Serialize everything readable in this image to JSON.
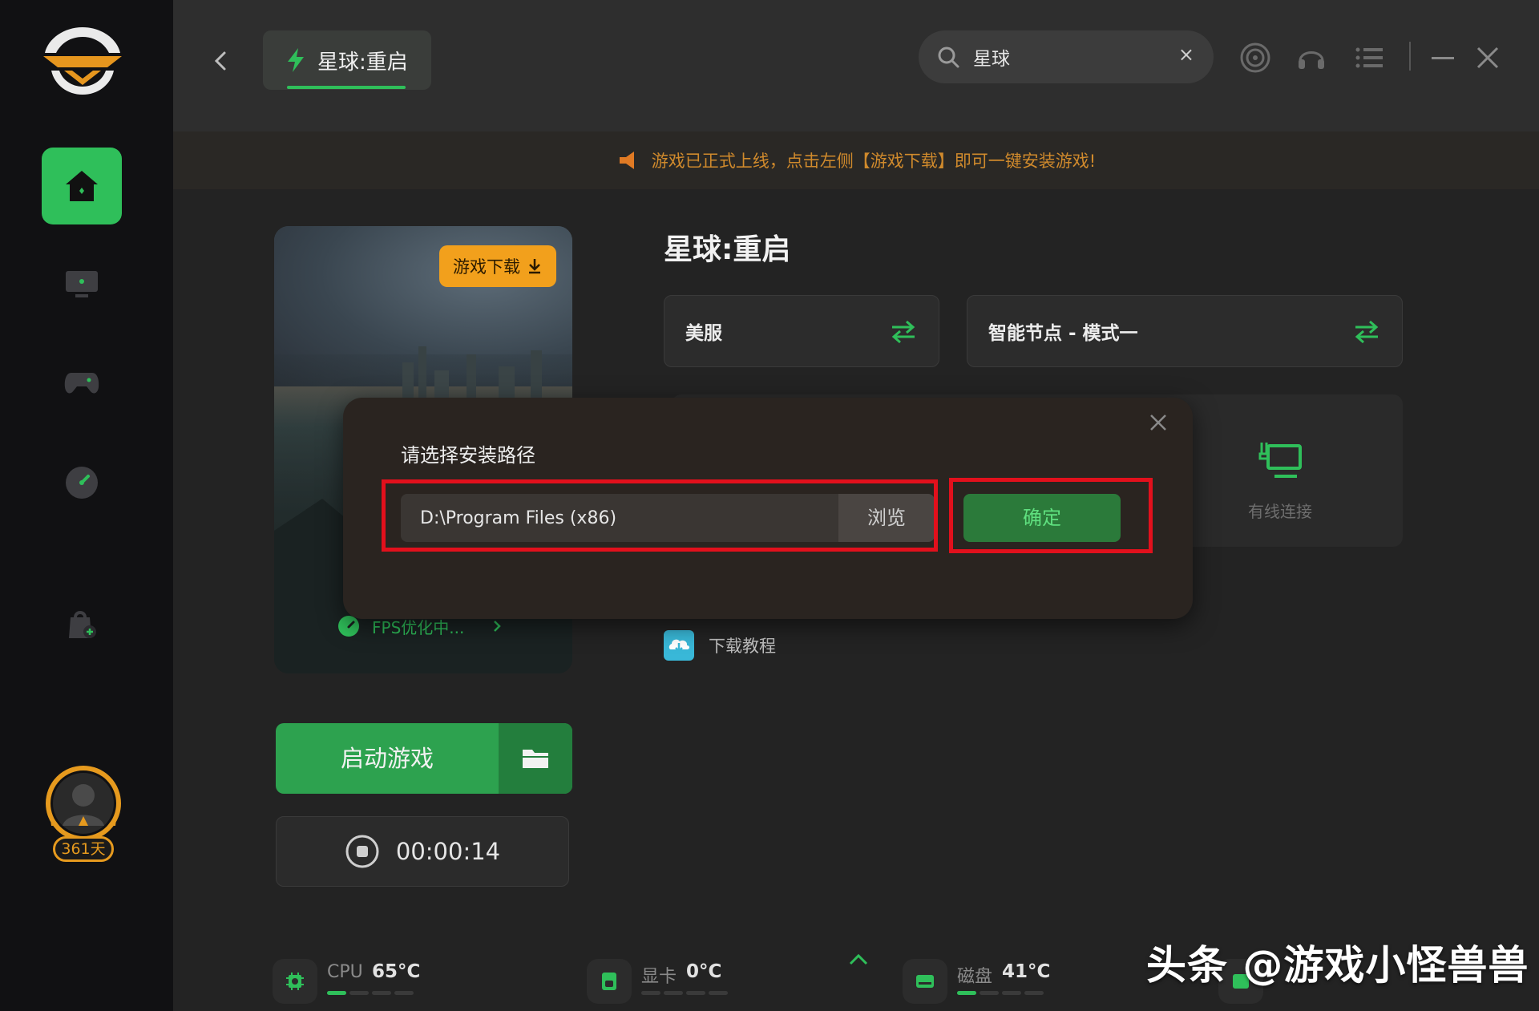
{
  "header": {
    "tab_label": "星球:重启",
    "search_value": "星球",
    "search_clear": "×"
  },
  "notice": {
    "text": "游戏已正式上线，点击左侧【游戏下载】即可一键安装游戏!"
  },
  "cover": {
    "download_badge": "游戏下载",
    "fps_status": "FPS优化中..."
  },
  "actions": {
    "launch_label": "启动游戏",
    "timer": "00:00:14"
  },
  "game": {
    "title": "星球:重启",
    "server": "美服",
    "node": "智能节点 - 模式一",
    "connection": "有线连接",
    "tutorial": "下载教程"
  },
  "dialog": {
    "title": "请选择安装路径",
    "path_value": "D:\\Program Files (x86)",
    "browse_label": "浏览",
    "confirm_label": "确定"
  },
  "profile": {
    "days": "361天"
  },
  "status": {
    "cpu_label": "CPU",
    "cpu_value": "65°C",
    "cpu_level": 0.3,
    "gpu_label": "显卡",
    "gpu_value": "0°C",
    "gpu_level": 0.0,
    "disk_label": "磁盘",
    "disk_value": "41°C",
    "disk_level": 0.2
  },
  "watermark": "头条 @游戏小怪兽兽",
  "colors": {
    "accent": "#2fbf5a",
    "notice": "#d08a2c",
    "badge": "#f2a01c",
    "highlight": "#e2101c"
  }
}
